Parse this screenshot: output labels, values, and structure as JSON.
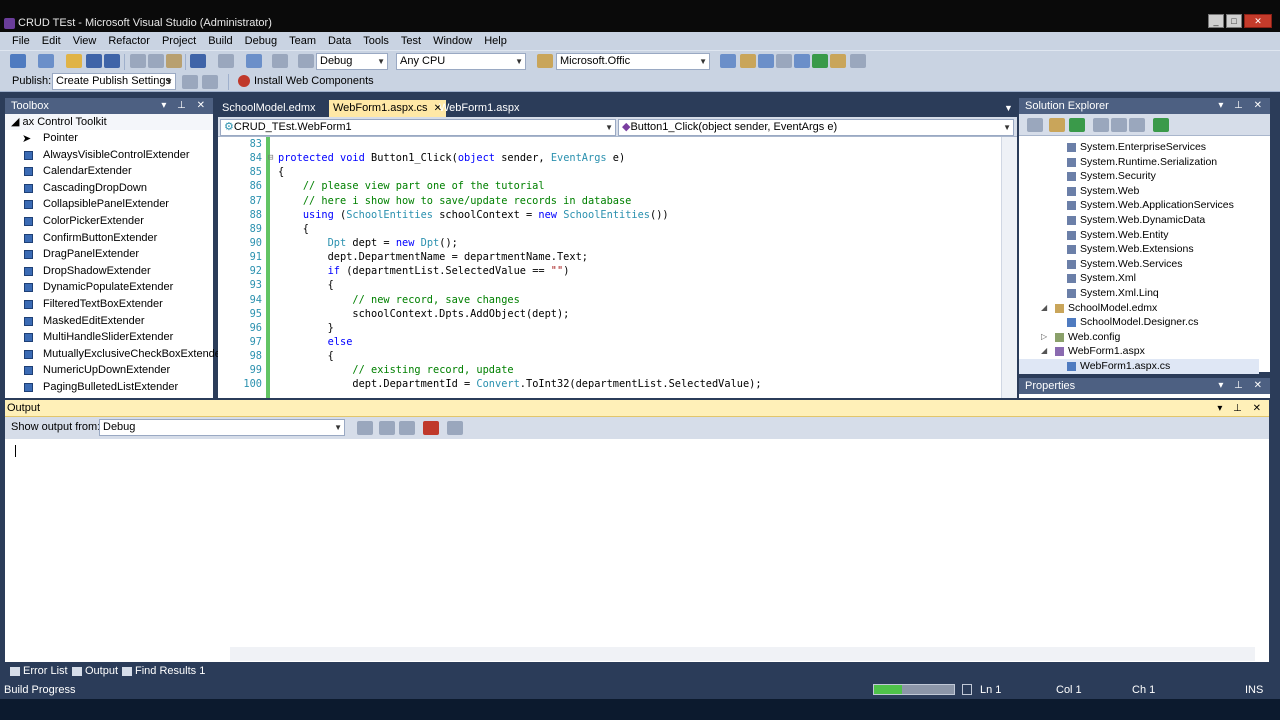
{
  "window": {
    "title": "CRUD TEst - Microsoft Visual Studio (Administrator)"
  },
  "menu": [
    "File",
    "Edit",
    "View",
    "Refactor",
    "Project",
    "Build",
    "Debug",
    "Team",
    "Data",
    "Tools",
    "Test",
    "Window",
    "Help"
  ],
  "toolbar": {
    "config": "Debug",
    "platform": "Any CPU",
    "find": "Microsoft.Offic",
    "publish_label": "Publish:",
    "publish_profile": "Create Publish Settings",
    "install_web": "Install Web Components"
  },
  "toolbox": {
    "title": "Toolbox",
    "group": "ax Control Toolkit",
    "items": [
      "Pointer",
      "AlwaysVisibleControlExtender",
      "CalendarExtender",
      "CascadingDropDown",
      "CollapsiblePanelExtender",
      "ColorPickerExtender",
      "ConfirmButtonExtender",
      "DragPanelExtender",
      "DropShadowExtender",
      "DynamicPopulateExtender",
      "FilteredTextBoxExtender",
      "MaskedEditExtender",
      "MultiHandleSliderExtender",
      "MutuallyExclusiveCheckBoxExtender",
      "NumericUpDownExtender",
      "PagingBulletedListExtender"
    ]
  },
  "editor": {
    "tabs": [
      "SchoolModel.edmx",
      "WebForm1.aspx.cs",
      "WebForm1.aspx"
    ],
    "nav_class": "CRUD_TEst.WebForm1",
    "nav_member": "Button1_Click(object sender, EventArgs e)",
    "lines": [
      {
        "n": "83",
        "t": ""
      },
      {
        "n": "84",
        "t": "protected void Button1_Click(object sender, EventArgs e)"
      },
      {
        "n": "85",
        "t": "{"
      },
      {
        "n": "86",
        "t": "    // please view part one of the tutorial"
      },
      {
        "n": "87",
        "t": "    // here i show how to save/update records in database"
      },
      {
        "n": "88",
        "t": "    using (SchoolEntities schoolContext = new SchoolEntities())"
      },
      {
        "n": "89",
        "t": "    {"
      },
      {
        "n": "90",
        "t": "        Dpt dept = new Dpt();"
      },
      {
        "n": "91",
        "t": "        dept.DepartmentName = departmentName.Text;"
      },
      {
        "n": "92",
        "t": "        if (departmentList.SelectedValue == \"\")"
      },
      {
        "n": "93",
        "t": "        {"
      },
      {
        "n": "94",
        "t": "            // new record, save changes"
      },
      {
        "n": "95",
        "t": "            schoolContext.Dpts.AddObject(dept);"
      },
      {
        "n": "96",
        "t": "        }"
      },
      {
        "n": "97",
        "t": "        else"
      },
      {
        "n": "98",
        "t": "        {"
      },
      {
        "n": "99",
        "t": "            // existing record, update"
      },
      {
        "n": "100",
        "t": "            dept.DepartmentId = Convert.ToInt32(departmentList.SelectedValue);"
      }
    ]
  },
  "solution": {
    "title": "Solution Explorer",
    "nodes": [
      {
        "label": "System.EnterpriseServices",
        "kind": "ref",
        "indent": 2
      },
      {
        "label": "System.Runtime.Serialization",
        "kind": "ref",
        "indent": 2
      },
      {
        "label": "System.Security",
        "kind": "ref",
        "indent": 2
      },
      {
        "label": "System.Web",
        "kind": "ref",
        "indent": 2
      },
      {
        "label": "System.Web.ApplicationServices",
        "kind": "ref",
        "indent": 2
      },
      {
        "label": "System.Web.DynamicData",
        "kind": "ref",
        "indent": 2
      },
      {
        "label": "System.Web.Entity",
        "kind": "ref",
        "indent": 2
      },
      {
        "label": "System.Web.Extensions",
        "kind": "ref",
        "indent": 2
      },
      {
        "label": "System.Web.Services",
        "kind": "ref",
        "indent": 2
      },
      {
        "label": "System.Xml",
        "kind": "ref",
        "indent": 2
      },
      {
        "label": "System.Xml.Linq",
        "kind": "ref",
        "indent": 2
      },
      {
        "label": "SchoolModel.edmx",
        "kind": "edmx",
        "indent": 1
      },
      {
        "label": "SchoolModel.Designer.cs",
        "kind": "cs",
        "indent": 2
      },
      {
        "label": "Web.config",
        "kind": "config",
        "indent": 1
      },
      {
        "label": "WebForm1.aspx",
        "kind": "aspx",
        "indent": 1
      },
      {
        "label": "WebForm1.aspx.cs",
        "kind": "cs",
        "indent": 2
      }
    ]
  },
  "properties": {
    "title": "Properties"
  },
  "output": {
    "title": "Output",
    "show_from_label": "Show output from:",
    "source": "Debug"
  },
  "bottom_tabs": [
    "Error List",
    "Output",
    "Find Results 1"
  ],
  "status": {
    "text": "Build Progress",
    "ln": "Ln 1",
    "col": "Col 1",
    "ch": "Ch 1",
    "mode": "INS",
    "progress": 0.35
  },
  "colors": {
    "accent": "#2b3c59",
    "active_tab": "#ffe8a6",
    "change_bar": "#62c464"
  }
}
